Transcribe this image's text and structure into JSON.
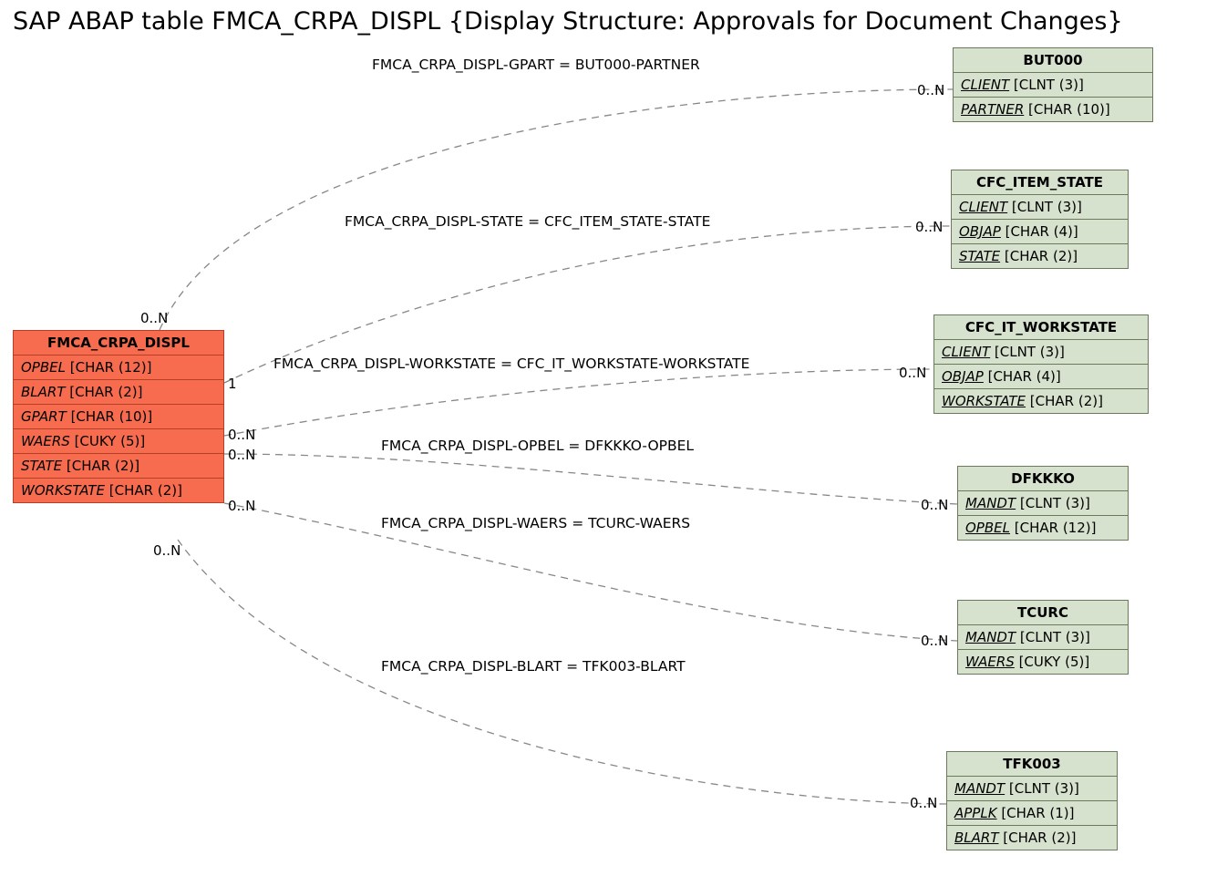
{
  "title": "SAP ABAP table FMCA_CRPA_DISPL {Display Structure: Approvals for Document Changes}",
  "main_entity": {
    "name": "FMCA_CRPA_DISPL",
    "fields": [
      {
        "name": "OPBEL",
        "type": "[CHAR (12)]",
        "key": false
      },
      {
        "name": "BLART",
        "type": "[CHAR (2)]",
        "key": false
      },
      {
        "name": "GPART",
        "type": "[CHAR (10)]",
        "key": false
      },
      {
        "name": "WAERS",
        "type": "[CUKY (5)]",
        "key": false
      },
      {
        "name": "STATE",
        "type": "[CHAR (2)]",
        "key": false
      },
      {
        "name": "WORKSTATE",
        "type": "[CHAR (2)]",
        "key": false
      }
    ]
  },
  "related_entities": [
    {
      "name": "BUT000",
      "fields": [
        {
          "name": "CLIENT",
          "type": "[CLNT (3)]",
          "key": true
        },
        {
          "name": "PARTNER",
          "type": "[CHAR (10)]",
          "key": true
        }
      ]
    },
    {
      "name": "CFC_ITEM_STATE",
      "fields": [
        {
          "name": "CLIENT",
          "type": "[CLNT (3)]",
          "key": true
        },
        {
          "name": "OBJAP",
          "type": "[CHAR (4)]",
          "key": true
        },
        {
          "name": "STATE",
          "type": "[CHAR (2)]",
          "key": true
        }
      ]
    },
    {
      "name": "CFC_IT_WORKSTATE",
      "fields": [
        {
          "name": "CLIENT",
          "type": "[CLNT (3)]",
          "key": true
        },
        {
          "name": "OBJAP",
          "type": "[CHAR (4)]",
          "key": true
        },
        {
          "name": "WORKSTATE",
          "type": "[CHAR (2)]",
          "key": true
        }
      ]
    },
    {
      "name": "DFKKKO",
      "fields": [
        {
          "name": "MANDT",
          "type": "[CLNT (3)]",
          "key": true
        },
        {
          "name": "OPBEL",
          "type": "[CHAR (12)]",
          "key": true
        }
      ]
    },
    {
      "name": "TCURC",
      "fields": [
        {
          "name": "MANDT",
          "type": "[CLNT (3)]",
          "key": true
        },
        {
          "name": "WAERS",
          "type": "[CUKY (5)]",
          "key": true
        }
      ]
    },
    {
      "name": "TFK003",
      "fields": [
        {
          "name": "MANDT",
          "type": "[CLNT (3)]",
          "key": true
        },
        {
          "name": "APPLK",
          "type": "[CHAR (1)]",
          "key": true
        },
        {
          "name": "BLART",
          "type": "[CHAR (2)]",
          "key": true
        }
      ]
    }
  ],
  "relationships": [
    {
      "label": "FMCA_CRPA_DISPL-GPART = BUT000-PARTNER",
      "left_card": "0..N",
      "right_card": "0..N"
    },
    {
      "label": "FMCA_CRPA_DISPL-STATE = CFC_ITEM_STATE-STATE",
      "left_card": "1",
      "right_card": "0..N"
    },
    {
      "label": "FMCA_CRPA_DISPL-WORKSTATE = CFC_IT_WORKSTATE-WORKSTATE",
      "left_card": "0..N",
      "right_card": "0..N"
    },
    {
      "label": "FMCA_CRPA_DISPL-OPBEL = DFKKKO-OPBEL",
      "left_card": "0..N",
      "right_card": "0..N"
    },
    {
      "label": "FMCA_CRPA_DISPL-WAERS = TCURC-WAERS",
      "left_card": "0..N",
      "right_card": "0..N"
    },
    {
      "label": "FMCA_CRPA_DISPL-BLART = TFK003-BLART",
      "left_card": "0..N",
      "right_card": "0..N"
    }
  ]
}
